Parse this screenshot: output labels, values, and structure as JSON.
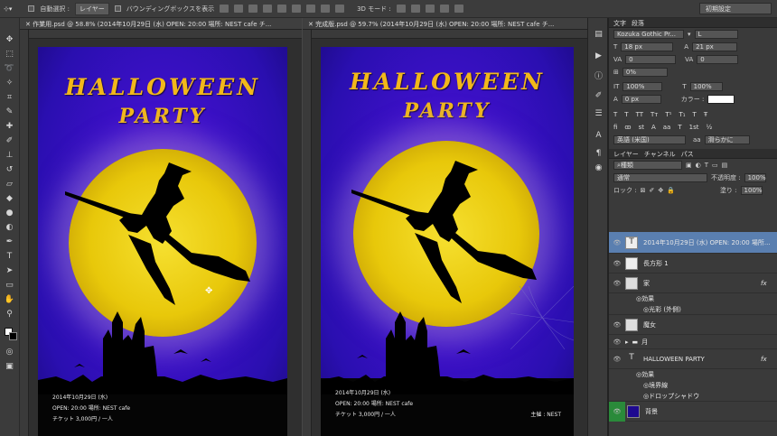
{
  "options_bar": {
    "auto_select_label": "自動選択 :",
    "auto_select_value": "レイヤー",
    "bounding_box_label": "バウンディングボックスを表示",
    "mode_3d_label": "3D モード :",
    "workspace": "初期設定"
  },
  "documents": [
    {
      "tab_title": "作業用.psd @ 58.8% (2014年10月29日 (水) OPEN: 20:00 場所: NEST cafe チ...",
      "title_line1": "HALLOWEEN",
      "title_line2": "PARTY",
      "info": [
        "2014年10月29日 (水)",
        "OPEN: 20:00 場所: NEST cafe",
        "チケット 3,000円 / 一人"
      ],
      "organizer": ""
    },
    {
      "tab_title": "完成版.psd @ 59.7% (2014年10月29日 (水) OPEN: 20:00 場所: NEST cafe チ...",
      "title_line1": "HALLOWEEN",
      "title_line2": "PARTY",
      "info": [
        "2014年10月29日 (水)",
        "OPEN: 20:00 場所: NEST cafe",
        "チケット 3,000円 / 一人"
      ],
      "organizer": "主催 : NEST"
    }
  ],
  "character_panel": {
    "tabs": [
      "文字",
      "段落"
    ],
    "font_family": "Kozuka Gothic Pr...",
    "font_style": "L",
    "font_size": "18 px",
    "leading": "21 px",
    "kerning": "0",
    "tracking": "0",
    "tsume": "0%",
    "vertical_scale": "100%",
    "horizontal_scale": "100%",
    "baseline_shift": "0 px",
    "color_label": "カラー :",
    "language": "英語 (米国)",
    "antialias": "滑らかに"
  },
  "layers_panel": {
    "tabs": [
      "レイヤー",
      "チャンネル",
      "パス"
    ],
    "filter_kind": "種類",
    "blend_mode": "通常",
    "opacity_label": "不透明度 :",
    "opacity_value": "100%",
    "lock_label": "ロック :",
    "fill_label": "塗り :",
    "fill_value": "100%",
    "layers": [
      {
        "name": "2014年10月29日 (水) OPEN: 20:00 場所...",
        "kind": "text",
        "selected": true
      },
      {
        "name": "長方形 1",
        "kind": "shape"
      },
      {
        "name": "家",
        "kind": "image",
        "fx": true
      },
      {
        "name": "効果",
        "kind": "effect"
      },
      {
        "name": "光彩 (外側)",
        "kind": "effect"
      },
      {
        "name": "魔女",
        "kind": "image"
      },
      {
        "name": "月",
        "kind": "group"
      },
      {
        "name": "HALLOWEEN PARTY",
        "kind": "text",
        "fx": true
      },
      {
        "name": "効果",
        "kind": "effect"
      },
      {
        "name": "境界線",
        "kind": "effect"
      },
      {
        "name": "ドロップシャドウ",
        "kind": "effect"
      },
      {
        "name": "背景",
        "kind": "background"
      }
    ]
  },
  "colors": {
    "accent": "#5a7fb0",
    "title_gold": "#f2b81a",
    "bg_green": "#2a8a3a"
  }
}
